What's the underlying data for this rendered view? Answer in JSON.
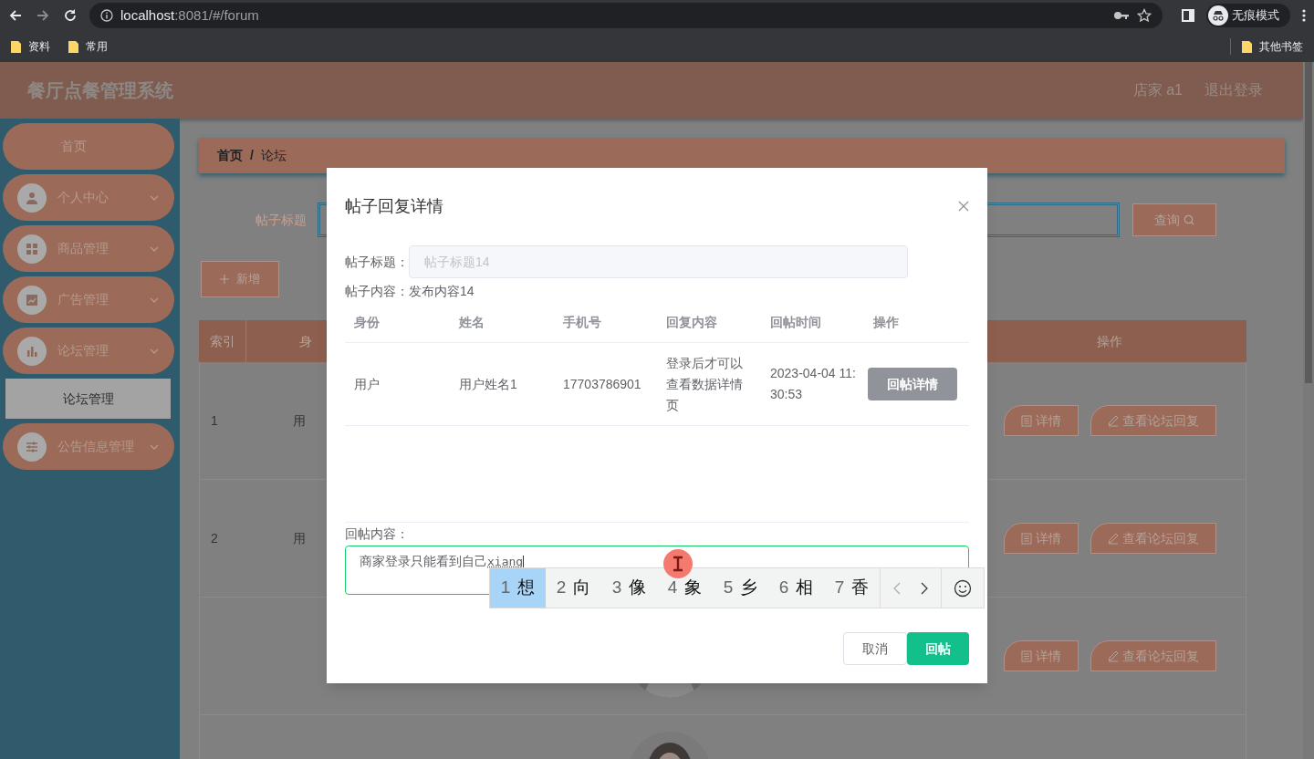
{
  "browser": {
    "url_host": "localhost",
    "url_path": ":8081/#/forum",
    "profile_label": "无痕模式",
    "bookmarks": [
      "资料",
      "常用"
    ],
    "other_bookmarks": "其他书签"
  },
  "header": {
    "title": "餐厅点餐管理系统",
    "user": "店家 a1",
    "logout": "退出登录"
  },
  "sidebar": {
    "items": [
      {
        "label": "首页"
      },
      {
        "label": "个人中心"
      },
      {
        "label": "商品管理"
      },
      {
        "label": "广告管理"
      },
      {
        "label": "论坛管理",
        "children": [
          {
            "label": "论坛管理",
            "selected": true
          }
        ]
      },
      {
        "label": "公告信息管理"
      }
    ]
  },
  "breadcrumb": {
    "items": [
      "首页",
      "论坛"
    ],
    "separator": "/"
  },
  "search": {
    "label": "帖子标题",
    "button": "查询"
  },
  "add_button": "新增",
  "table": {
    "columns": [
      "索引",
      "身",
      "操作"
    ],
    "rows": [
      {
        "index": "1",
        "column_2": "用",
        "actions": [
          "详情",
          "查看论坛回复"
        ]
      },
      {
        "index": "2",
        "column_2": "用",
        "actions": [
          "详情",
          "查看论坛回复"
        ]
      },
      {
        "actions": [
          "详情",
          "查看论坛回复"
        ],
        "picture": true
      },
      {
        "picture": true
      }
    ]
  },
  "dialog": {
    "title": "帖子回复详情",
    "post_title": {
      "label": "帖子标题：",
      "value": "帖子标题14",
      "disabled": true
    },
    "post_content": {
      "label": "帖子内容：",
      "value": "发布内容14"
    },
    "replies": {
      "columns": [
        "身份",
        "姓名",
        "手机号",
        "回复内容",
        "回帖时间",
        "操作"
      ],
      "rows": [
        {
          "role": "用户",
          "name": "用户姓名1",
          "phone": "17703786901",
          "content": "登录后才可以查看数据详情页",
          "time": "2023-04-04 11:30:53",
          "action": "回帖详情"
        }
      ]
    },
    "reply": {
      "label": "回帖内容：",
      "value": "商家登录只能看到自己",
      "composition": "xiang"
    },
    "buttons": [
      {
        "label": "取消",
        "kind": "plain"
      },
      {
        "label": "回帖",
        "kind": "primary"
      }
    ]
  },
  "ime": {
    "candidates": [
      {
        "number": "1",
        "text": "想",
        "selected": true
      },
      {
        "number": "2",
        "text": "向",
        "selected": false
      },
      {
        "number": "3",
        "text": "像",
        "selected": false
      },
      {
        "number": "4",
        "text": "象",
        "selected": false
      },
      {
        "number": "5",
        "text": "乡",
        "selected": false
      },
      {
        "number": "6",
        "text": "相",
        "selected": false
      },
      {
        "number": "7",
        "text": "香",
        "selected": false
      }
    ]
  }
}
